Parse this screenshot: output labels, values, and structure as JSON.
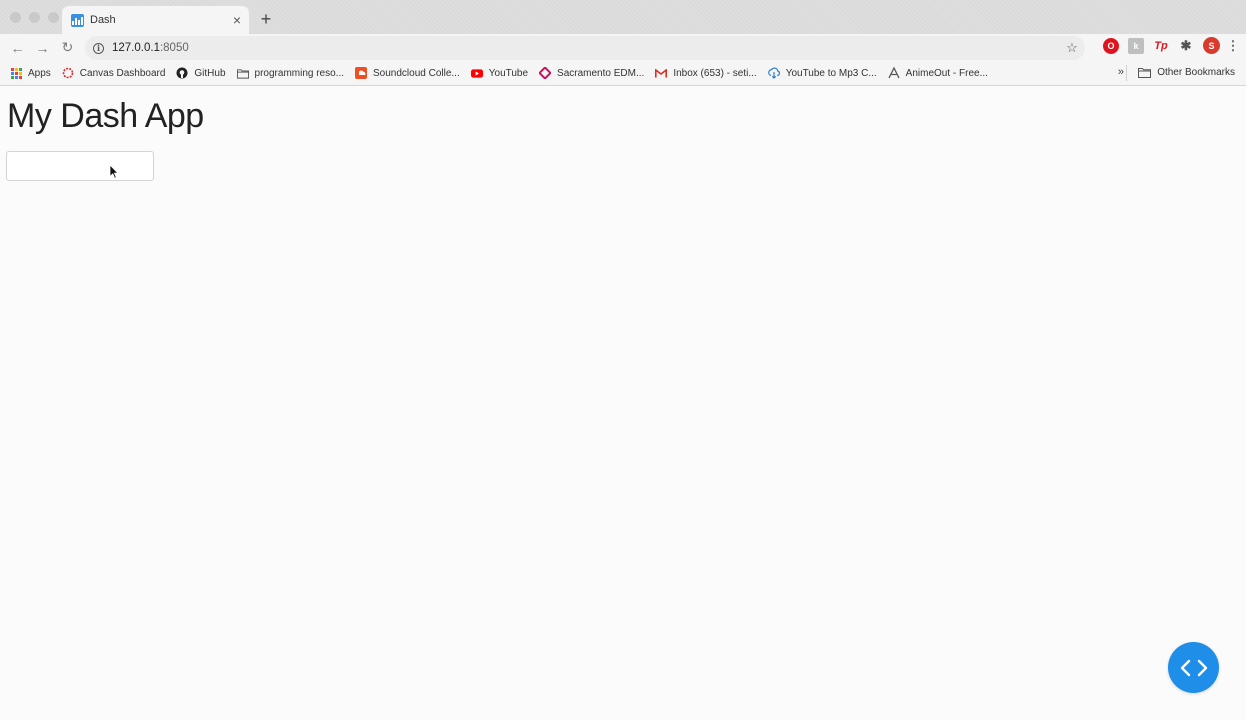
{
  "tab": {
    "title": "Dash",
    "close_glyph": "×",
    "new_tab_glyph": "+",
    "favicon": "dash-chart-icon",
    "favicon_color": "#3a8fe0"
  },
  "toolbar": {
    "url_host": "127.0.0.1",
    "url_port": ":8050",
    "back_glyph": "←",
    "forward_glyph": "→",
    "reload_glyph": "↻",
    "star_glyph": "☆",
    "menu_glyph": "⋮",
    "profile_initial": "S"
  },
  "bookmarks": {
    "items": [
      {
        "label": "Apps",
        "icon": "apps-grid-icon"
      },
      {
        "label": "Canvas Dashboard",
        "icon": "canvas-icon"
      },
      {
        "label": "GitHub",
        "icon": "github-icon"
      },
      {
        "label": "programming reso...",
        "icon": "folder-icon"
      },
      {
        "label": "Soundcloud Colle...",
        "icon": "soundcloud-icon"
      },
      {
        "label": "YouTube",
        "icon": "youtube-icon"
      },
      {
        "label": "Sacramento EDM...",
        "icon": "sacramento-icon"
      },
      {
        "label": "Inbox (653) - seti...",
        "icon": "gmail-icon"
      },
      {
        "label": "YouTube to Mp3 C...",
        "icon": "download-icon"
      },
      {
        "label": "AnimeOut - Free...",
        "icon": "animeout-icon"
      }
    ],
    "overflow_glyph": "»",
    "other_label": "Other Bookmarks"
  },
  "page": {
    "heading": "My Dash App",
    "input_value": "",
    "accent": "#1f8ee8"
  }
}
